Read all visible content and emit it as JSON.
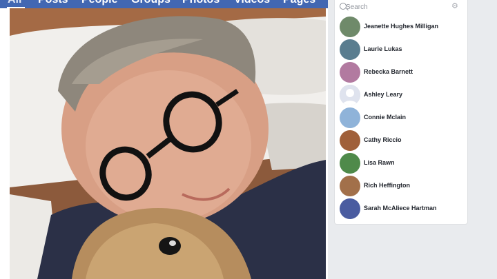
{
  "tabs": [
    {
      "label": "All",
      "active": true
    },
    {
      "label": "Posts"
    },
    {
      "label": "People"
    },
    {
      "label": "Groups"
    },
    {
      "label": "Photos"
    },
    {
      "label": "Videos"
    },
    {
      "label": "Pages"
    }
  ],
  "contacts_panel": {
    "search_placeholder": "Search",
    "contacts": [
      {
        "name": "Jeanette Hughes Milligan",
        "avatar_color": "#6f8a6a"
      },
      {
        "name": "Laurie Lukas",
        "avatar_color": "#5a7d8f"
      },
      {
        "name": "Rebecka Barnett",
        "avatar_color": "#b27aa0"
      },
      {
        "name": "Ashley Leary",
        "avatar_color": "#c9ccd1"
      },
      {
        "name": "Connie Mclain",
        "avatar_color": "#8fb3d9"
      },
      {
        "name": "Cathy Riccio",
        "avatar_color": "#a0603a"
      },
      {
        "name": "Lisa Rawn",
        "avatar_color": "#4f8a4a"
      },
      {
        "name": "Rich Heffington",
        "avatar_color": "#a2704a"
      },
      {
        "name": "Sarah McAliece Hartman",
        "avatar_color": "#4a5ca0"
      }
    ]
  },
  "colors": {
    "brand_blue": "#4267b2",
    "page_bg": "#e9ebee",
    "name_text": "#1d2129",
    "muted_text": "#90949c"
  }
}
